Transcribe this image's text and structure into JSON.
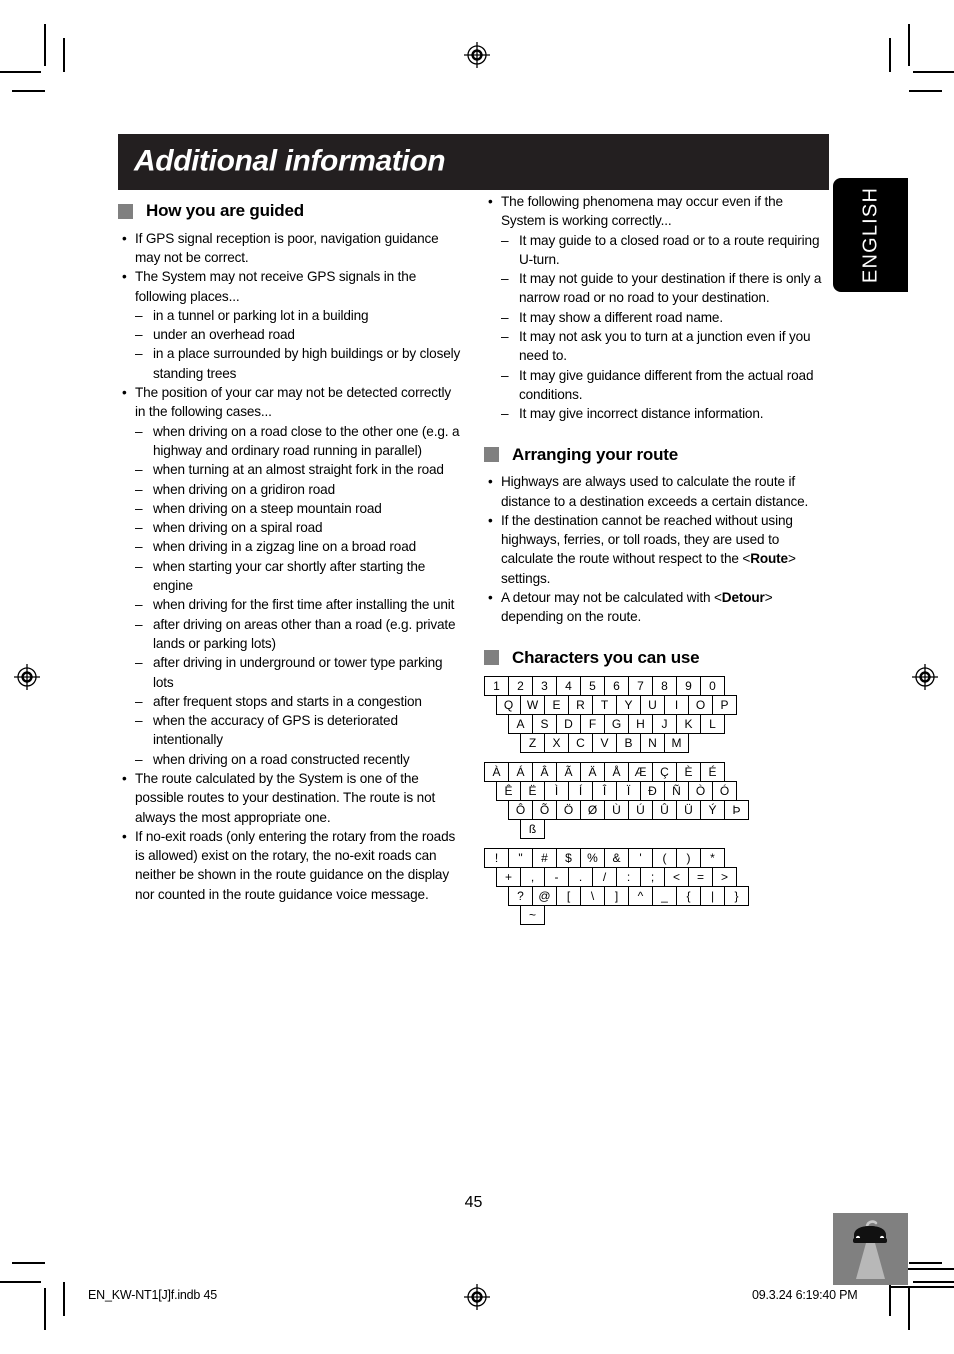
{
  "chapter": {
    "title": "Additional information"
  },
  "language_tab": {
    "label": "ENGLISH"
  },
  "left_column": {
    "section": {
      "heading": "How you are guided",
      "bullet_marker": "•",
      "dash_marker": "–"
    },
    "items": [
      {
        "text": "If GPS signal reception is poor, navigation guidance may not be correct.",
        "subitems": []
      },
      {
        "text": "The System may not receive GPS signals in the following places...",
        "subitems": [
          "in a tunnel or parking lot in a building",
          "under an overhead road",
          "in a place surrounded by high buildings or by closely standing trees"
        ]
      },
      {
        "text": "The position of your car may not be detected correctly in the following cases...",
        "subitems": [
          "when driving on a road close to the other one (e.g. a highway and ordinary road running in parallel)",
          "when turning at an almost straight fork in the road",
          "when driving on a gridiron road",
          "when driving on a steep mountain road",
          "when driving on a spiral road",
          "when driving in a zigzag line on a broad road",
          "when starting your car shortly after starting the engine",
          "when driving for the first time after installing the unit",
          "after driving on areas other than a road (e.g. private lands or parking lots)",
          "after driving in underground or tower type parking lots",
          "after frequent stops and starts in a congestion",
          "when the accuracy of GPS is deteriorated intentionally",
          "when driving on a road constructed recently"
        ]
      },
      {
        "text": "The route calculated by the System is one of the possible routes to your destination. The route is not always the most appropriate one.",
        "subitems": []
      },
      {
        "text": "If no-exit roads (only entering the rotary from the roads is allowed) exist on the rotary, the no-exit roads can neither be shown in the route guidance on the display nor counted in the route guidance voice message.",
        "subitems": []
      }
    ]
  },
  "right_column": {
    "guided_continued": [
      {
        "text": "The following phenomena may occur even if the System is working correctly...",
        "subitems": [
          "It may guide to a closed road or to a route requiring U-turn.",
          "It may not guide to your destination if there is only a narrow road or no road to your destination.",
          "It may show a different road name.",
          "It may not ask you to turn at a junction even if you need to.",
          "It may give guidance different from the actual road conditions.",
          "It may give incorrect distance information."
        ]
      }
    ],
    "arranging_section": {
      "heading": "Arranging your route",
      "items": [
        {
          "parts": [
            {
              "t": "Highways are always used to calculate the route if distance to a destination exceeds a certain distance.",
              "bold": false
            }
          ]
        },
        {
          "parts": [
            {
              "t": "If the destination cannot be reached without using highways, ferries, or toll roads, they are used to calculate the route without respect to the <",
              "bold": false
            },
            {
              "t": "Route",
              "bold": true
            },
            {
              "t": "> settings.",
              "bold": false
            }
          ]
        },
        {
          "parts": [
            {
              "t": "A detour may not be calculated with <",
              "bold": false
            },
            {
              "t": "Detour",
              "bold": true
            },
            {
              "t": "> depending on the route.",
              "bold": false
            }
          ]
        }
      ]
    },
    "characters_section": {
      "heading": "Characters you can use",
      "keyboard_groups": [
        {
          "name": "alphanumeric",
          "rows": [
            {
              "indent": 0,
              "keys": [
                "1",
                "2",
                "3",
                "4",
                "5",
                "6",
                "7",
                "8",
                "9",
                "0"
              ]
            },
            {
              "indent": 12,
              "keys": [
                "Q",
                "W",
                "E",
                "R",
                "T",
                "Y",
                "U",
                "I",
                "O",
                "P"
              ]
            },
            {
              "indent": 24,
              "keys": [
                "A",
                "S",
                "D",
                "F",
                "G",
                "H",
                "J",
                "K",
                "L"
              ]
            },
            {
              "indent": 36,
              "keys": [
                "Z",
                "X",
                "C",
                "V",
                "B",
                "N",
                "M"
              ]
            }
          ]
        },
        {
          "name": "accented",
          "rows": [
            {
              "indent": 0,
              "keys": [
                "À",
                "Á",
                "Â",
                "Ã",
                "Ä",
                "Å",
                "Æ",
                "Ç",
                "È",
                "É"
              ]
            },
            {
              "indent": 12,
              "keys": [
                "Ê",
                "Ë",
                "Ì",
                "Í",
                "Î",
                "Ï",
                "Ð",
                "Ñ",
                "Ò",
                "Ó"
              ]
            },
            {
              "indent": 24,
              "keys": [
                "Ô",
                "Õ",
                "Ö",
                "Ø",
                "Ù",
                "Ú",
                "Û",
                "Ü",
                "Ý",
                "Þ"
              ]
            },
            {
              "indent": 36,
              "keys": [
                "ß"
              ]
            }
          ]
        },
        {
          "name": "symbols",
          "rows": [
            {
              "indent": 0,
              "keys": [
                "!",
                "\"",
                "#",
                "$",
                "%",
                "&",
                "'",
                "(",
                ")",
                "*"
              ]
            },
            {
              "indent": 12,
              "keys": [
                "+",
                ",",
                "-",
                ".",
                "/",
                ":",
                ";",
                "<",
                "=",
                ">"
              ]
            },
            {
              "indent": 24,
              "keys": [
                "?",
                "@",
                "[",
                "\\",
                "]",
                "^",
                "_",
                "{",
                "|",
                "}"
              ]
            },
            {
              "indent": 36,
              "keys": [
                "~"
              ]
            }
          ]
        }
      ]
    }
  },
  "page_number": "45",
  "footer": {
    "file_name": "EN_KW-NT1[J]f.indb   45",
    "timestamp": "09.3.24   6:19:40 PM"
  }
}
